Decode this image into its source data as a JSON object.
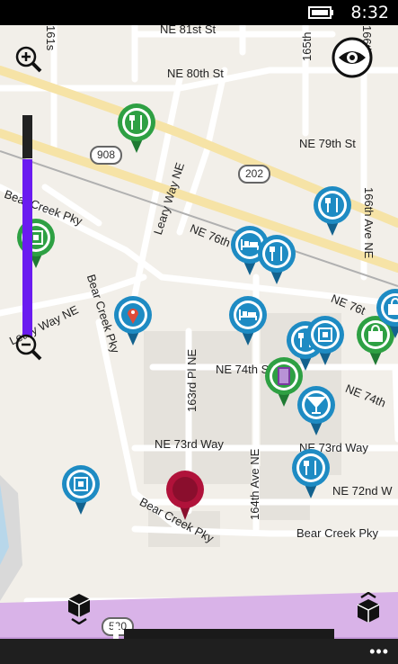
{
  "status_bar": {
    "time": "8:32"
  },
  "map": {
    "streets": [
      {
        "id": "ne81",
        "label": "NE 81st St"
      },
      {
        "id": "ne80",
        "label": "NE 80th St"
      },
      {
        "id": "ne79",
        "label": "NE 79th St"
      },
      {
        "id": "ne76",
        "label": "NE 76th"
      },
      {
        "id": "ne76b",
        "label": "NE 76t"
      },
      {
        "id": "ne74",
        "label": "NE 74th St"
      },
      {
        "id": "ne74b",
        "label": "NE 74th"
      },
      {
        "id": "ne73",
        "label": "NE 73rd Way"
      },
      {
        "id": "ne73b",
        "label": "NE 73rd Way"
      },
      {
        "id": "ne72",
        "label": "NE 72nd W"
      },
      {
        "id": "bcp",
        "label": "Bear Creek Pky"
      },
      {
        "id": "bcp2",
        "label": "Bear Creek Pky"
      },
      {
        "id": "bcp3",
        "label": "Bear Creek Pky"
      },
      {
        "id": "bcp4",
        "label": "Bear Creek Pky"
      },
      {
        "id": "leary1",
        "label": "Leary Way NE"
      },
      {
        "id": "leary2",
        "label": "Leary Way NE"
      },
      {
        "id": "p163",
        "label": "163rd Pl NE"
      },
      {
        "id": "a164",
        "label": "164th Ave NE"
      },
      {
        "id": "a164b",
        "label": "164th"
      },
      {
        "id": "a165",
        "label": "165th"
      },
      {
        "id": "a166",
        "label": "166th Ave NE"
      },
      {
        "id": "a161",
        "label": "161s"
      },
      {
        "id": "a166top",
        "label": "166th"
      }
    ],
    "route_shields": [
      "908",
      "202",
      "520"
    ]
  },
  "pins": [
    {
      "icon": "fork-knife-icon",
      "color": "green"
    },
    {
      "icon": "fork-knife-icon",
      "color": "blue"
    },
    {
      "icon": "box-icon",
      "color": "green"
    },
    {
      "icon": "bed-icon",
      "color": "blue"
    },
    {
      "icon": "fork-knife-icon",
      "color": "blue"
    },
    {
      "icon": "map-marker-icon",
      "color": "blue"
    },
    {
      "icon": "bed-icon",
      "color": "blue"
    },
    {
      "icon": "fork-knife-icon",
      "color": "blue"
    },
    {
      "icon": "box-icon",
      "color": "blue"
    },
    {
      "icon": "shopping-bag-icon",
      "color": "green"
    },
    {
      "icon": "shopping-bag-icon",
      "color": "blue"
    },
    {
      "icon": "film-icon",
      "color": "green"
    },
    {
      "icon": "cocktail-icon",
      "color": "blue"
    },
    {
      "icon": "fork-knife-icon",
      "color": "blue"
    },
    {
      "icon": "box-icon",
      "color": "blue"
    }
  ],
  "colors": {
    "pin_blue": "#1e8bc3",
    "pin_green": "#2ea043",
    "zoom_fill": "#6a1bf0",
    "current_location": "#b0123a"
  },
  "zoom_level_fraction": 0.8
}
